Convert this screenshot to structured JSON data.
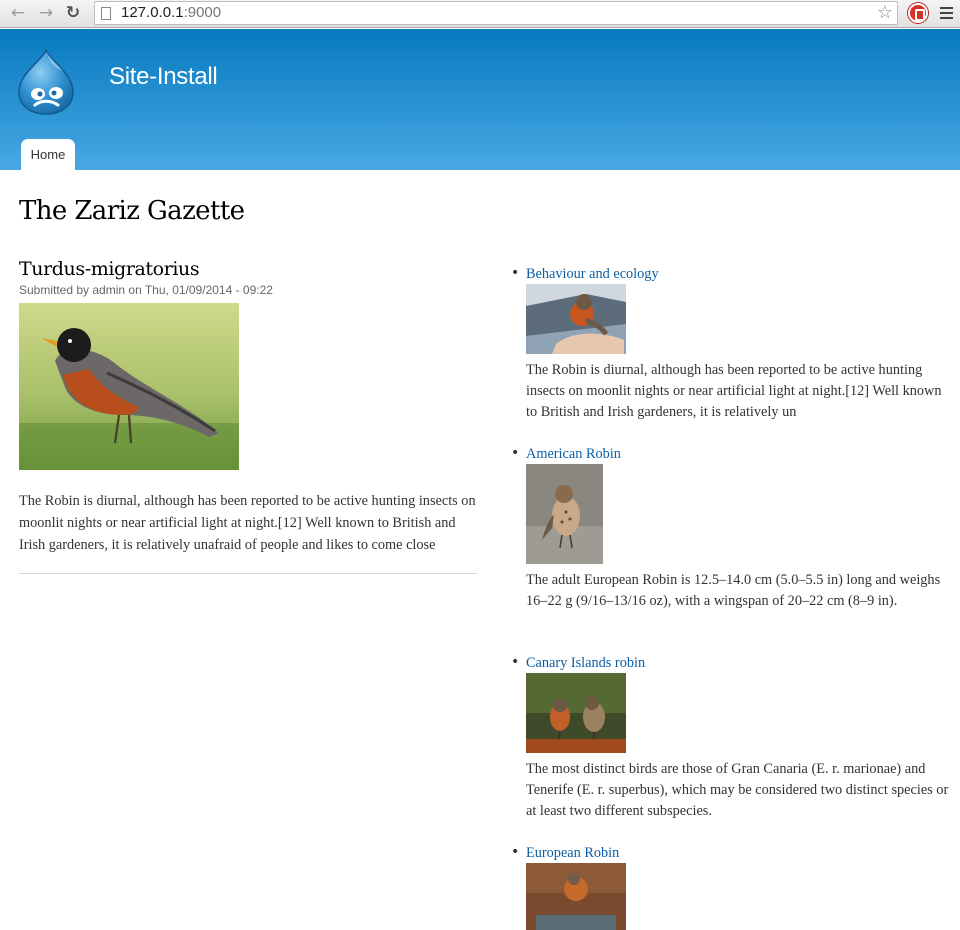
{
  "browser": {
    "url_host": "127.0.0.1",
    "url_port": ":9000",
    "back_icon": "arrow-left-icon",
    "forward_icon": "arrow-right-icon",
    "reload_icon": "reload-icon",
    "bookmark_icon": "star-icon",
    "extension_icon": "adblock-icon",
    "menu_icon": "hamburger-menu-icon"
  },
  "header": {
    "site_name": "Site-Install",
    "logo": "drupal-drop-logo",
    "tabs": [
      {
        "label": "Home"
      }
    ],
    "colors": {
      "top": "#0779bf",
      "bottom": "#48a9e4"
    }
  },
  "main": {
    "page_title": "The Zariz Gazette",
    "article": {
      "title": "Turdus-migratorius",
      "meta": "Submitted by admin on Thu, 01/09/2014 - 09:22",
      "body": "The Robin is diurnal, although has been reported to be active hunting insects on moonlit nights or near artificial light at night.[12] Well known to British and Irish gardeners, it is relatively unafraid of people and likes to come close"
    }
  },
  "sidebar": {
    "items": [
      {
        "label": "Behaviour and ecology",
        "text": "The Robin is diurnal, although has been reported to be active hunting insects on moonlit nights or near artificial light at night.[12] Well known to British and Irish gardeners, it is relatively un"
      },
      {
        "label": "American Robin",
        "text": "The adult European Robin is 12.5–14.0 cm (5.0–5.5 in) long and weighs 16–22 g (9/16–13/16 oz), with a wingspan of 20–22 cm (8–9 in)."
      },
      {
        "label": "Canary Islands robin",
        "text": "The most distinct birds are those of Gran Canaria (E. r. marionae) and Tenerife (E. r. superbus), which may be considered two distinct species or at least two different subspecies."
      },
      {
        "label": "European Robin",
        "text": ""
      }
    ]
  },
  "colors": {
    "link": "#0b5ea6",
    "text": "#333333"
  }
}
